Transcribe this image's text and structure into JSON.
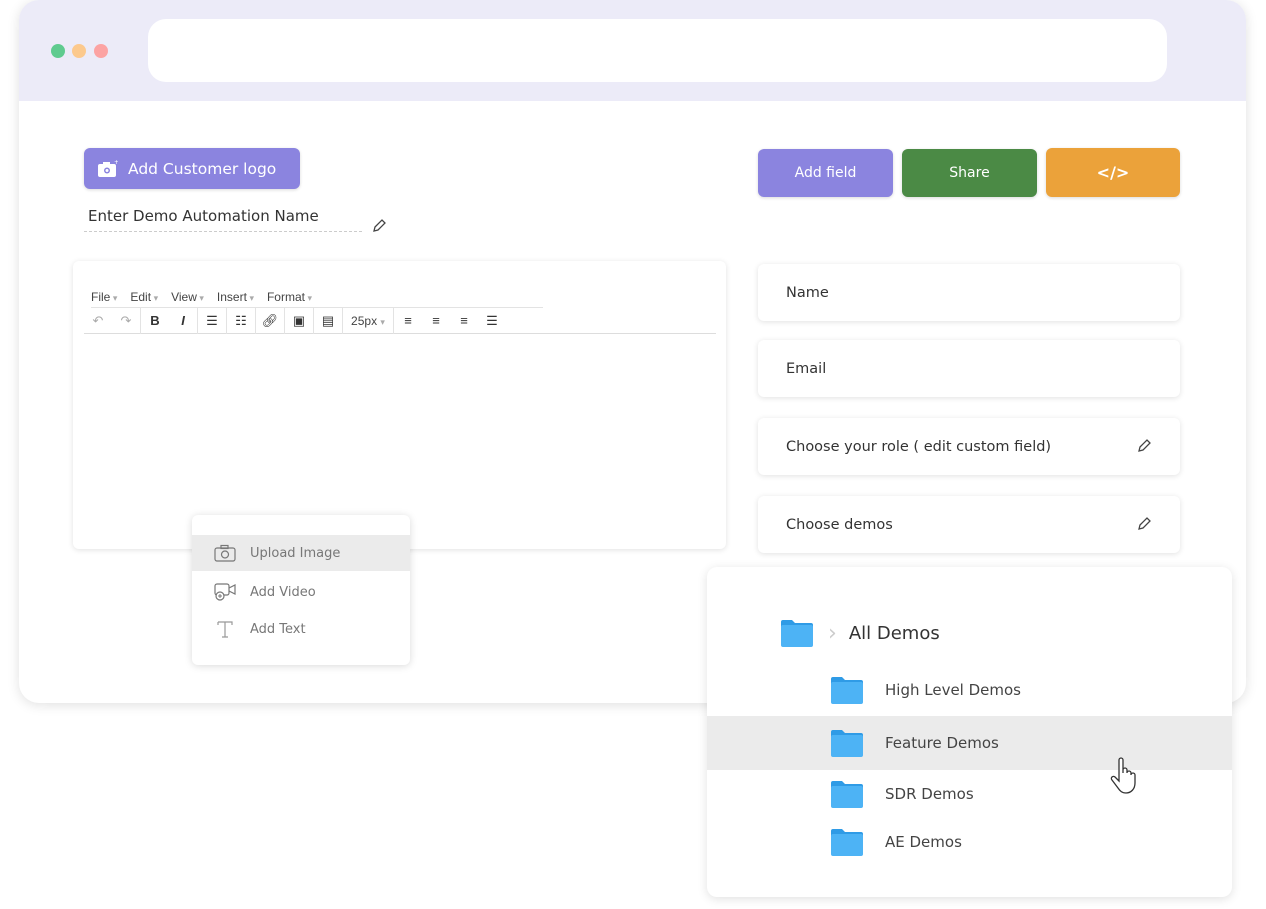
{
  "window": {
    "dots": {
      "green": "#5fcb8f",
      "orange": "#fcc98d",
      "red": "#fca3a3"
    }
  },
  "header": {
    "add_logo_label": "Add Customer logo",
    "name_placeholder": "Enter Demo Automation Name"
  },
  "actions": {
    "add_field": "Add field",
    "share": "Share",
    "embed": "</>"
  },
  "colors": {
    "purple": "#8b84df",
    "green": "#4b8a45",
    "orange": "#eba23a",
    "folder": "#4db3f5"
  },
  "editor": {
    "menu": [
      "File",
      "Edit",
      "View",
      "Insert",
      "Format"
    ],
    "font_size": "25px"
  },
  "insert_menu": {
    "items": [
      {
        "label": "Upload Image",
        "icon": "camera-icon"
      },
      {
        "label": "Add Video",
        "icon": "video-icon"
      },
      {
        "label": "Add Text",
        "icon": "text-icon"
      }
    ]
  },
  "fields": [
    {
      "label": "Name"
    },
    {
      "label": "Email"
    },
    {
      "label": "Choose your role ( edit custom field)",
      "editable": true
    },
    {
      "label": "Choose demos",
      "editable": true
    }
  ],
  "folders": {
    "root": "All Demos",
    "items": [
      "High Level Demos",
      "Feature Demos",
      "SDR Demos",
      "AE Demos"
    ],
    "hovered": "Feature Demos"
  }
}
